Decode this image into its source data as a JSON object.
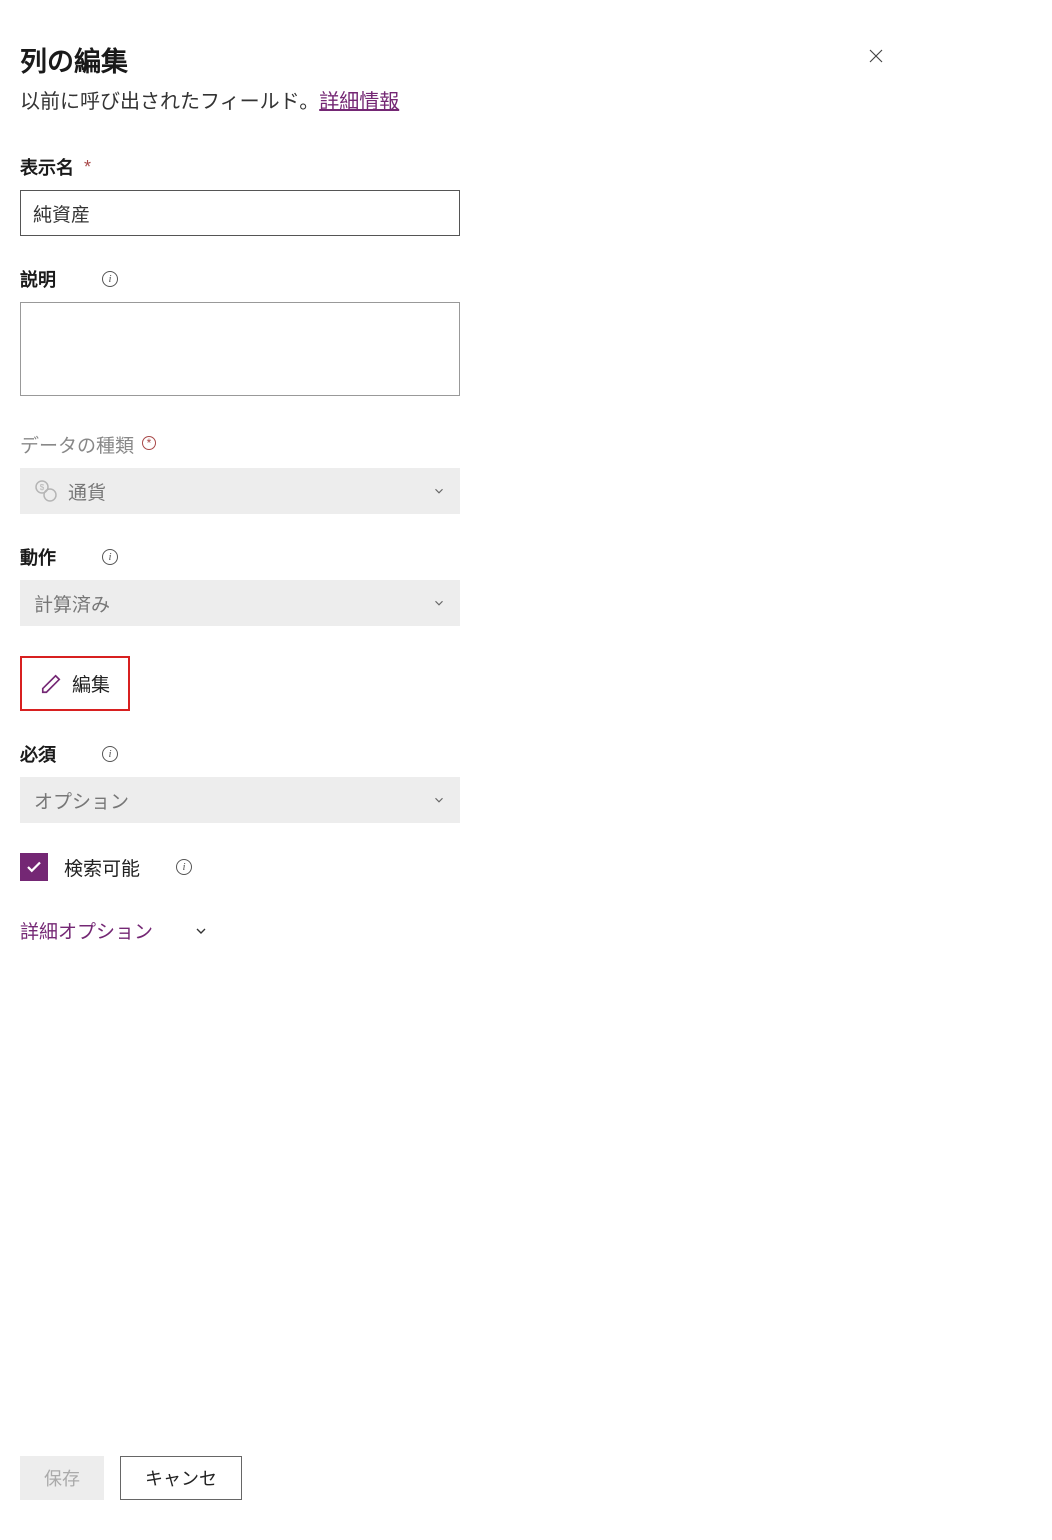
{
  "header": {
    "title": "列の編集"
  },
  "subtitle": {
    "text": "以前に呼び出されたフィールド。",
    "link": "詳細情報"
  },
  "displayName": {
    "label": "表示名",
    "value": "純資産"
  },
  "description": {
    "label": "説明",
    "value": ""
  },
  "dataType": {
    "label": "データの種類",
    "value": "通貨"
  },
  "behavior": {
    "label": "動作",
    "value": "計算済み"
  },
  "editButton": {
    "label": "編集"
  },
  "required": {
    "label": "必須",
    "value": "オプション"
  },
  "searchable": {
    "label": "検索可能",
    "checked": true
  },
  "advancedOptions": {
    "label": "詳細オプション"
  },
  "footer": {
    "save": "保存",
    "cancel": "キャンセ"
  }
}
